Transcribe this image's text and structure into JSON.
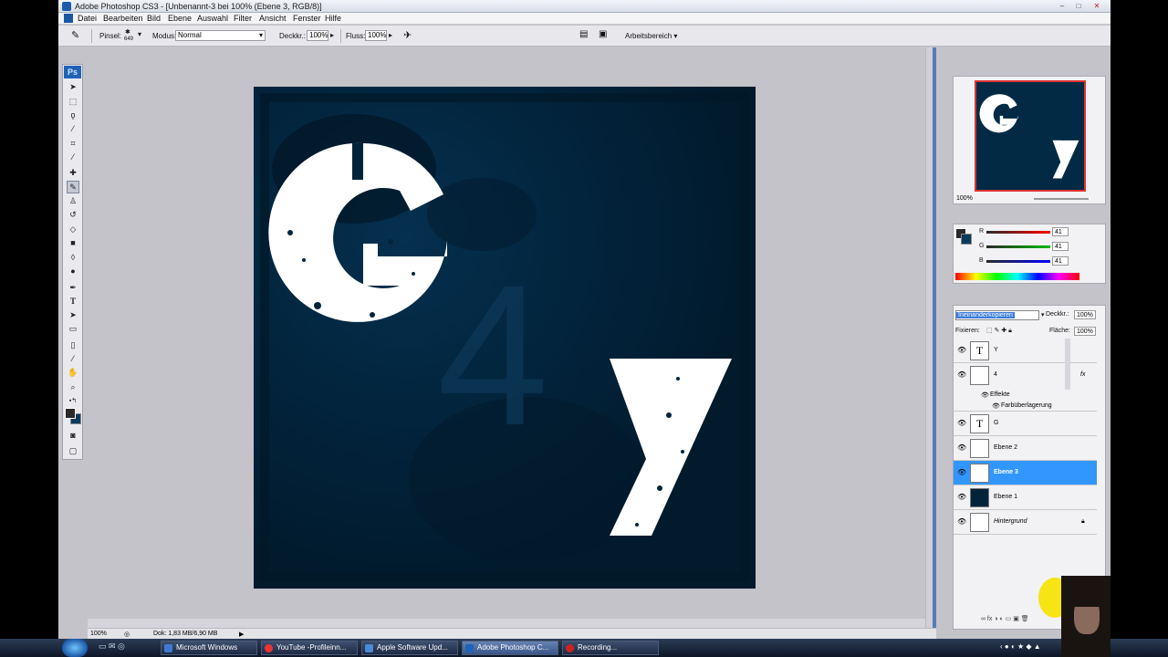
{
  "window": {
    "title": "Adobe Photoshop CS3 - [Unbenannt-3 bei 100% (Ebene 3, RGB/8)]",
    "minimize": "–",
    "maximize": "□",
    "close": "✕"
  },
  "menu": [
    "Datei",
    "Bearbeiten",
    "Bild",
    "Ebene",
    "Auswahl",
    "Filter",
    "Ansicht",
    "Fenster",
    "Hilfe"
  ],
  "options": {
    "brush_label": "Pinsel:",
    "brush_size": "649",
    "mode_label": "Modus:",
    "mode_value": "Normal",
    "opacity_label": "Deckkr.:",
    "opacity_value": "100%",
    "flow_label": "Fluss:",
    "flow_value": "100%",
    "workspace": "Arbeitsbereich ▾"
  },
  "toolbox": {
    "logo": "Ps",
    "tools": [
      "move-tool",
      "marquee-tool",
      "lasso-tool",
      "magic-wand-tool",
      "crop-tool",
      "eyedropper-tool",
      "healing-brush-tool",
      "brush-tool",
      "clone-stamp-tool",
      "history-brush-tool",
      "eraser-tool",
      "gradient-tool",
      "blur-tool",
      "dodge-tool",
      "pen-tool",
      "type-tool",
      "path-selection-tool",
      "shape-tool",
      "notes-tool",
      "eyedropper2-tool",
      "hand-tool",
      "zoom-tool"
    ],
    "active_tool": "brush-tool",
    "foreground_color": "#292929",
    "background_color": "#0a3a5e"
  },
  "canvas": {
    "big_letter": "G",
    "faint_digit": "4",
    "small_letter": "y",
    "bg_color": "#02243b"
  },
  "status": {
    "zoom": "100%",
    "doc_size": "Dok: 1,83 MB/6,90 MB"
  },
  "navigator": {
    "zoom": "100%"
  },
  "color_panel": {
    "r_label": "R",
    "g_label": "G",
    "b_label": "B",
    "r_value": "41",
    "g_value": "41",
    "b_value": "41"
  },
  "layers_panel": {
    "blend_mode": "Ineinanderkopieren",
    "opacity_label": "Deckkr.:",
    "opacity_value": "100%",
    "lock_label": "Fixieren:",
    "fill_label": "Fläche:",
    "fill_value": "100%",
    "layers": [
      {
        "name": "Y",
        "kind": "text"
      },
      {
        "name": "4",
        "kind": "pixel",
        "fx": "fx"
      },
      {
        "name": "G",
        "kind": "text"
      },
      {
        "name": "Ebene 2",
        "kind": "pixel"
      },
      {
        "name": "Ebene 3",
        "kind": "pixel",
        "selected": true
      },
      {
        "name": "Ebene 1",
        "kind": "dark"
      },
      {
        "name": "Hintergrund",
        "kind": "background"
      }
    ],
    "effects_label": "Effekte",
    "effect_item": "Farbüberlagerung",
    "text_thumb": "T"
  },
  "taskbar": {
    "items": [
      {
        "label": "Microsoft Windows",
        "color": "#3a7bd5"
      },
      {
        "label": "YouTube -Profileinn...",
        "color": "#e33"
      },
      {
        "label": "Apple Software Upd...",
        "color": "#4a8ad4"
      },
      {
        "label": "Adobe Photoshop C...",
        "color": "#1f63b8"
      },
      {
        "label": "Recording...",
        "color": "#c22"
      }
    ]
  }
}
